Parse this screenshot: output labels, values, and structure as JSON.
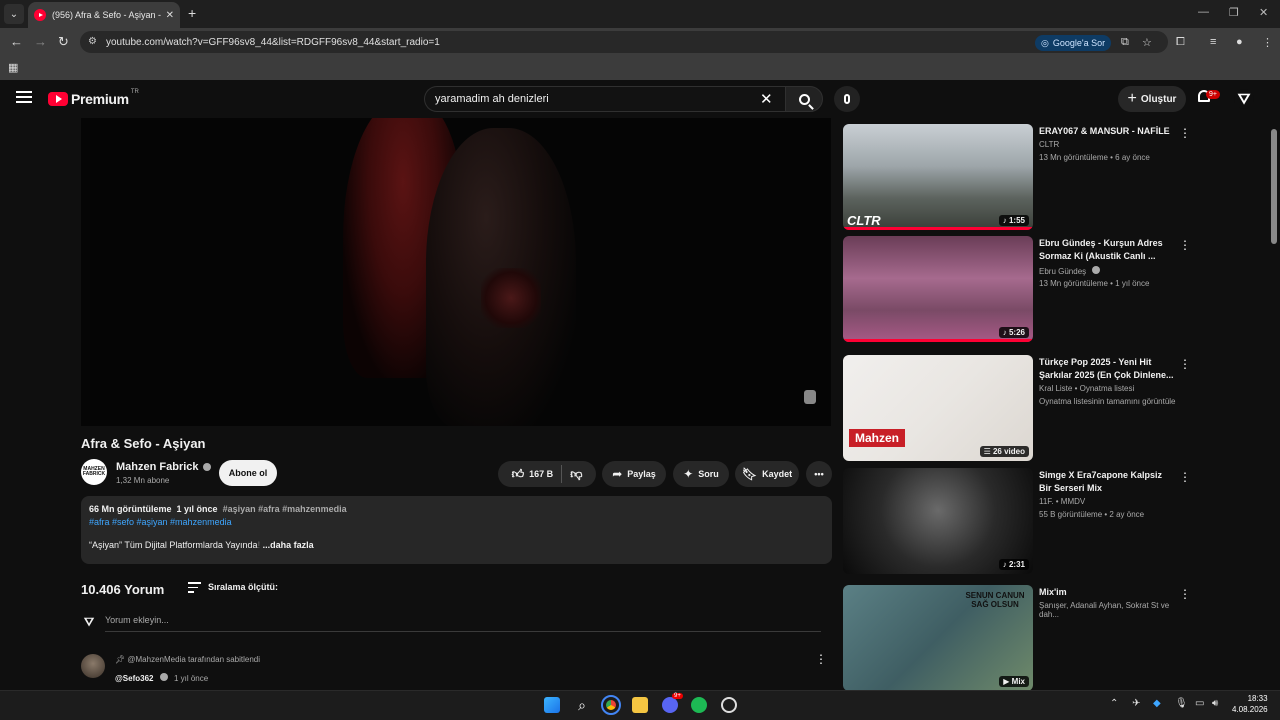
{
  "browser": {
    "tab_title": "(956) Afra & Sefo - Aşiyan - You",
    "url": "youtube.com/watch?v=GFF96sv8_44&list=RDGFF96sv8_44&start_radio=1",
    "google_sor": "Google'a Sor"
  },
  "header": {
    "logo_word": "Premium",
    "logo_region": "TR",
    "search_value": "yaramadim ah denizleri",
    "create_label": "Oluştur",
    "notif_badge": "9+"
  },
  "video": {
    "title": "Afra & Sefo - Aşiyan",
    "channel_avatar_text": "MAHZEN FABRICK",
    "channel": "Mahzen Fabrick",
    "subscribers": "1,32 Mn abone",
    "subscribe_label": "Abone ol",
    "likes": "167 B",
    "share_label": "Paylaş",
    "ask_label": "Soru",
    "save_label": "Kaydet"
  },
  "description": {
    "views": "66 Mn görüntüleme",
    "age": "1 yıl önce",
    "tags_inline": "#aşiyan #afra #mahzenmedia",
    "tags_line": "#afra #sefo #aşiyan #mahzenmedia",
    "text": "“Aşiyan” Tüm Dijital Platformlarda Yayında",
    "text_fade": "!",
    "more": "...daha fazla"
  },
  "comments": {
    "count": "10.406 Yorum",
    "sort_label": "Sıralama ölçütü:",
    "placeholder": "Yorum ekleyin...",
    "pinned_note": "@MahzenMedia tarafından sabitlendi",
    "first_author": "@Sefo362",
    "first_age": "1 yıl önce"
  },
  "sidebar": [
    {
      "title": "ERAY067 & MANSUR - NAFİLE",
      "channel": "CLTR",
      "meta": "13 Mn görüntüleme • 6 ay önce",
      "duration": "1:55",
      "brand": "CLTR"
    },
    {
      "title": "Ebru Gündeş - Kurşun Adres Sormaz Ki (Akustik Canlı ...",
      "channel": "Ebru Gündeş",
      "meta": "13 Mn görüntüleme • 1 yıl önce",
      "duration": "5:26"
    },
    {
      "title": "Türkçe Pop 2025 - Yeni Hit Şarkılar 2025 (En Çok Dinlene...",
      "channel": "Kral Liste • Oynatma listesi",
      "meta": "Oynatma listesinin tamamını görüntüle",
      "duration": "26 video",
      "brand": "Mahzen"
    },
    {
      "title": "Simge X Era7capone  Kalpsiz Bir Serseri Mix",
      "channel": "11F. • MMDV",
      "meta": "55 B görüntüleme • 2 ay önce",
      "duration": "2:31"
    },
    {
      "title": "Mix'im",
      "channel": "Şanışer, Adanali Ayhan, Sokrat St ve dah...",
      "meta": "",
      "duration": "Mix",
      "brand": "SENUN CANUN SAĞ OLSUN"
    }
  ],
  "taskbar": {
    "time": "18:33",
    "date": "4.08.2026",
    "discord_badge": "9+"
  },
  "colors": {
    "yt_red": "#ff0033",
    "bg": "#0f0f0f",
    "pill": "#272727",
    "link": "#3ea6ff"
  }
}
